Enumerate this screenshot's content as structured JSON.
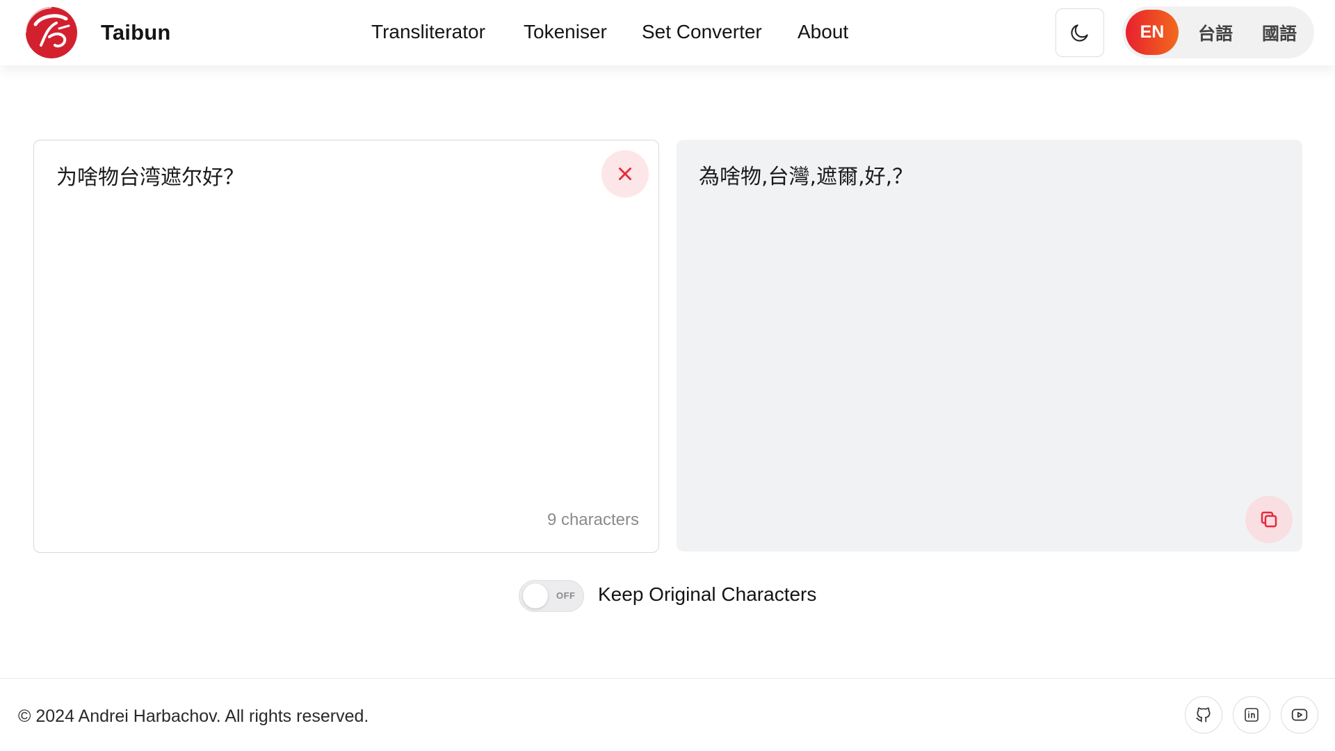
{
  "header": {
    "brand": "Taibun",
    "nav": [
      {
        "label": "Transliterator"
      },
      {
        "label": "Tokeniser"
      },
      {
        "label": "Set Converter"
      },
      {
        "label": "About"
      }
    ],
    "theme_icon": "moon-icon",
    "languages": [
      {
        "label": "EN",
        "active": true
      },
      {
        "label": "台語",
        "active": false
      },
      {
        "label": "國語",
        "active": false
      }
    ]
  },
  "input": {
    "text": "为啥物台湾遮尔好？",
    "char_count": "9 characters",
    "clear_icon": "close-icon"
  },
  "output": {
    "text": "為啥物,台灣,遮爾,好,？",
    "copy_icon": "copy-icon"
  },
  "options": {
    "toggle_state": "OFF",
    "toggle_label": "Keep Original Characters"
  },
  "footer": {
    "copyright": "© 2024 Andrei Harbachov. All rights reserved.",
    "social": [
      "github-icon",
      "linkedin-icon",
      "youtube-icon"
    ]
  },
  "colors": {
    "accent_start": "#e8202f",
    "accent_end": "#f26a1c",
    "accent_red": "#e8283a",
    "clear_bg": "#fde6e8",
    "output_bg": "#f1f2f4"
  }
}
